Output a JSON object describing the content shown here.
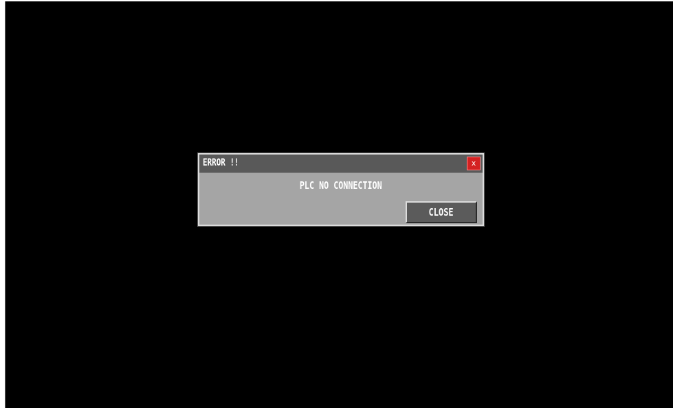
{
  "dialog": {
    "title": "ERROR !!",
    "close_icon_glyph": "x",
    "message": "PLC NO CONNECTION",
    "close_button_label": "CLOSE"
  },
  "colors": {
    "screen_background": "#000000",
    "dialog_background": "#a5a5a5",
    "titlebar": "#595959",
    "close_icon_background": "#d42222",
    "button_background": "#5b5b5b",
    "text": "#ffffff"
  }
}
